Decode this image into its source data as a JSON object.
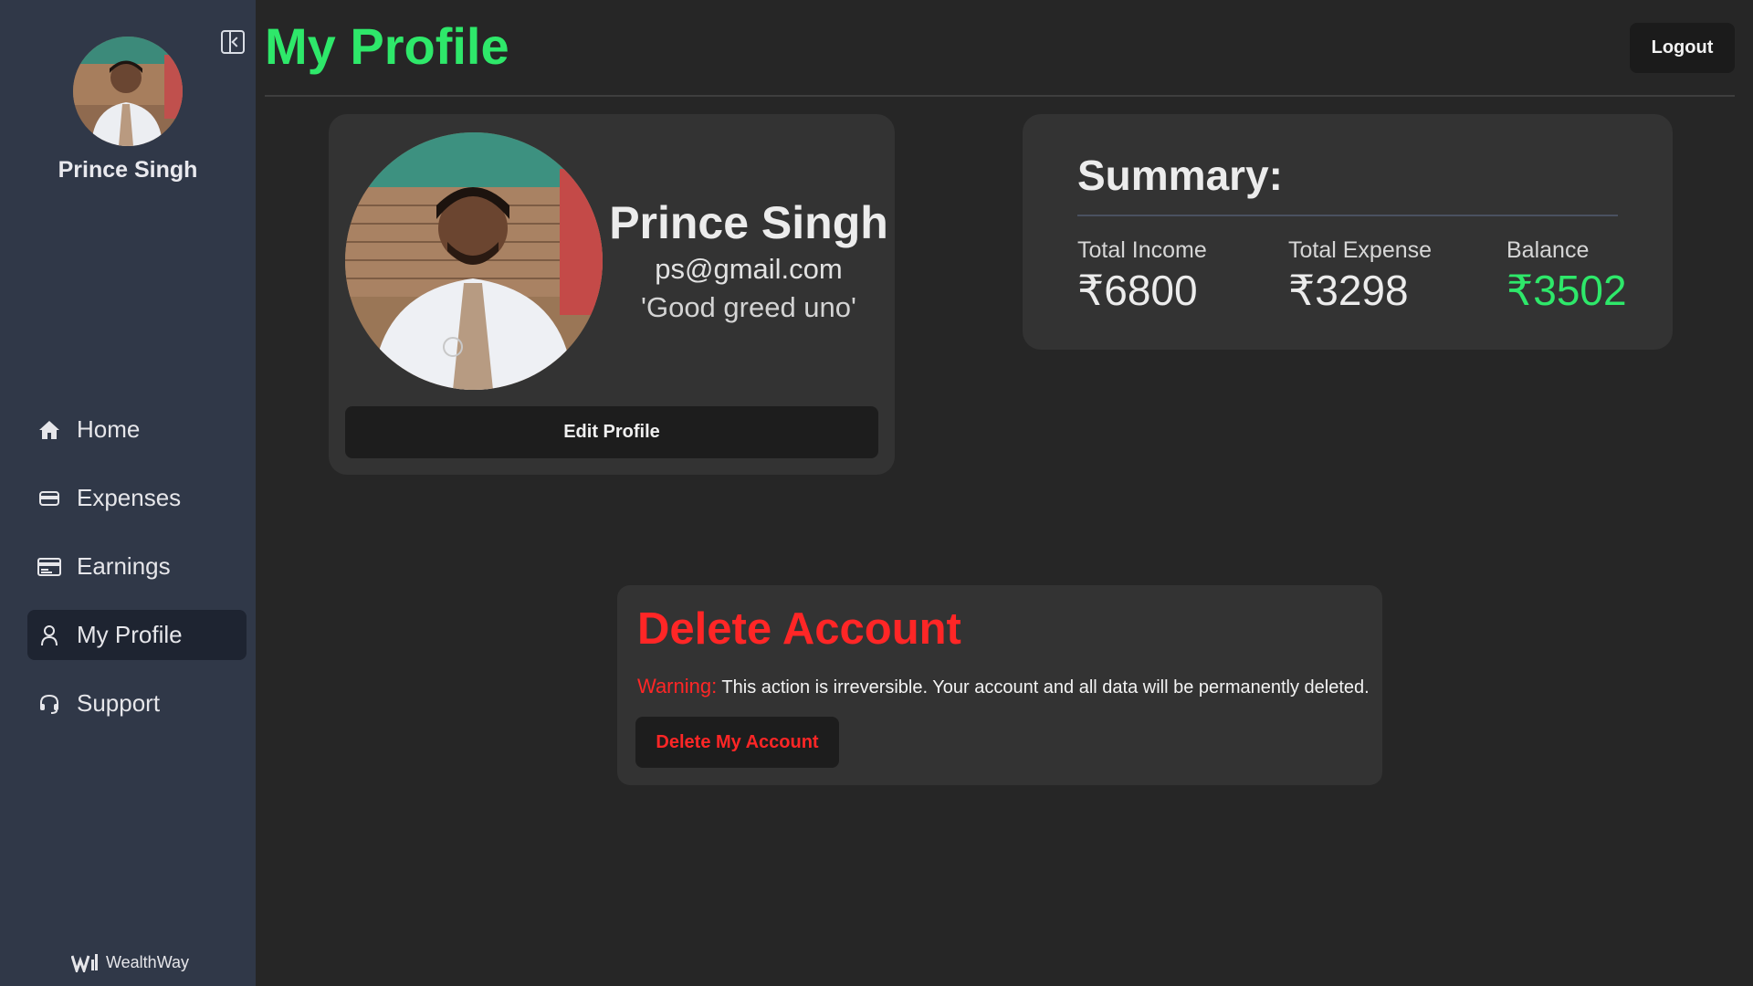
{
  "sidebar": {
    "user_name": "Prince Singh",
    "items": [
      {
        "label": "Home",
        "icon": "home-icon"
      },
      {
        "label": "Expenses",
        "icon": "wallet-icon"
      },
      {
        "label": "Earnings",
        "icon": "card-icon"
      },
      {
        "label": "My Profile",
        "icon": "user-icon",
        "active": true
      },
      {
        "label": "Support",
        "icon": "headset-icon"
      }
    ],
    "brand": "WealthWay"
  },
  "header": {
    "title": "My Profile",
    "logout_label": "Logout"
  },
  "profile": {
    "name": "Prince Singh",
    "email": "ps@gmail.com",
    "motto": "'Good greed uno'",
    "edit_label": "Edit Profile"
  },
  "summary": {
    "title": "Summary:",
    "income_label": "Total Income",
    "income_value": "₹6800",
    "expense_label": "Total Expense",
    "expense_value": "₹3298",
    "balance_label": "Balance",
    "balance_value": "₹3502"
  },
  "delete_account": {
    "title": "Delete Account",
    "warning_label": "Warning:",
    "warning_text": " This action is irreversible. Your account and all data will be permanently deleted.",
    "button_label": "Delete My Account"
  },
  "colors": {
    "accent_green": "#2ee86a",
    "danger_red": "#ff2626",
    "sidebar_bg": "#303848",
    "page_bg": "#262626",
    "card_bg": "#333333"
  }
}
